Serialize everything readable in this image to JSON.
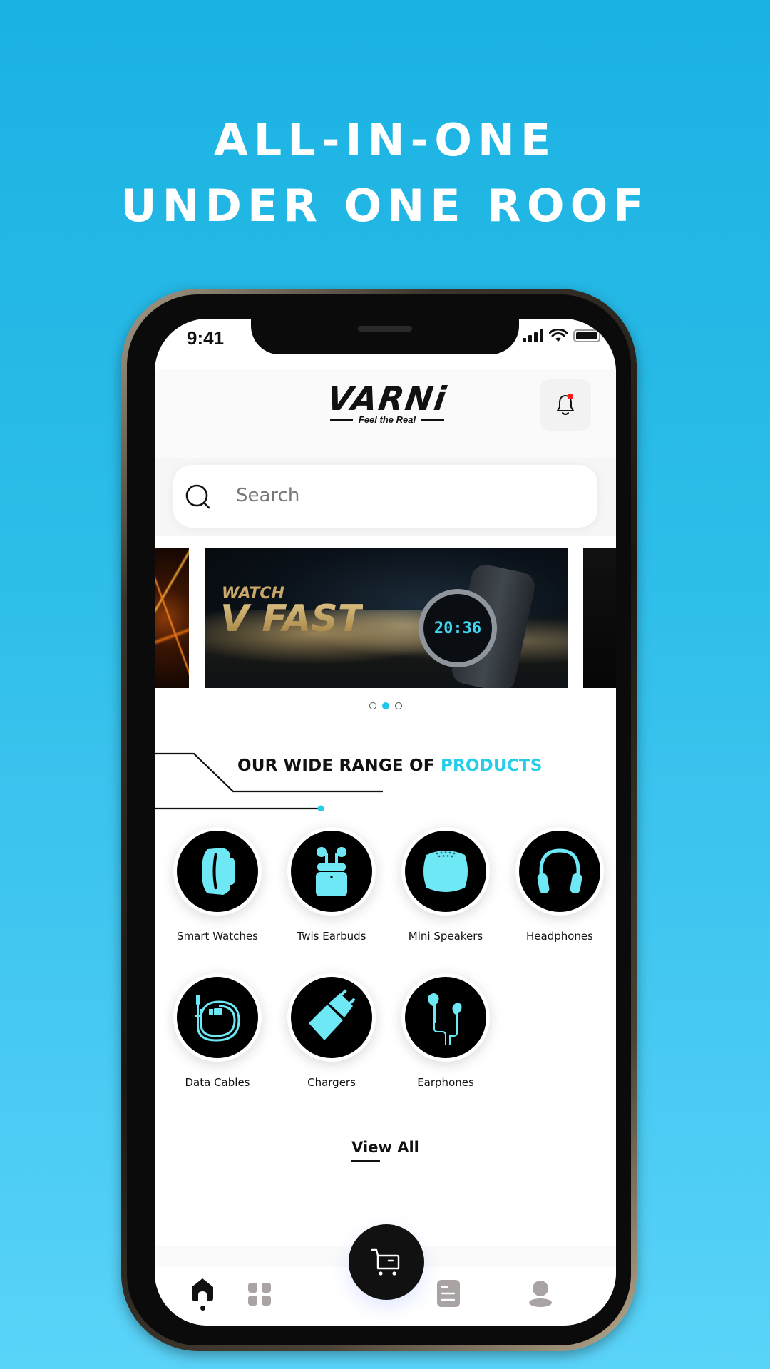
{
  "promo": {
    "headline_line1": "ALL-IN-ONE",
    "headline_line2": "UNDER ONE ROOF"
  },
  "status_bar": {
    "time": "9:41",
    "icons": [
      "signal-icon",
      "wifi-icon",
      "battery-icon"
    ]
  },
  "header": {
    "brand": "VARNi",
    "tagline": "Feel the Real",
    "notification_icon": "bell-icon",
    "has_unread": true
  },
  "search": {
    "placeholder": "Search",
    "icon": "search-icon"
  },
  "banner": {
    "label_small": "WATCH",
    "label_big": "V FAST",
    "watch_time": "20:36",
    "slide_count": 3,
    "active_slide": 2
  },
  "section": {
    "title_prefix": "OUR WIDE RANGE OF",
    "title_accent": "PRODUCTS"
  },
  "categories": [
    {
      "label": "Smart Watches",
      "icon": "smartwatch-icon"
    },
    {
      "label": "Twis Earbuds",
      "icon": "earbuds-icon"
    },
    {
      "label": "Mini Speakers",
      "icon": "speaker-icon"
    },
    {
      "label": "Headphones",
      "icon": "headphones-icon"
    },
    {
      "label": "Data Cables",
      "icon": "cable-icon"
    },
    {
      "label": "Chargers",
      "icon": "charger-icon"
    },
    {
      "label": "Earphones",
      "icon": "earphones-icon"
    }
  ],
  "view_all_label": "View All",
  "bottom_nav": {
    "items": [
      {
        "name": "home",
        "icon": "home-icon",
        "active": true
      },
      {
        "name": "categories",
        "icon": "grid-icon",
        "active": false
      },
      {
        "name": "cart",
        "icon": "cart-icon",
        "active": false
      },
      {
        "name": "orders",
        "icon": "document-icon",
        "active": false
      },
      {
        "name": "profile",
        "icon": "user-icon",
        "active": false
      }
    ]
  },
  "colors": {
    "accent": "#26cde6",
    "icon_fill": "#6fe8f5",
    "background_top": "#1ab2e2",
    "background_bottom": "#5ad3f8",
    "notification_dot": "#ff1a1a"
  }
}
